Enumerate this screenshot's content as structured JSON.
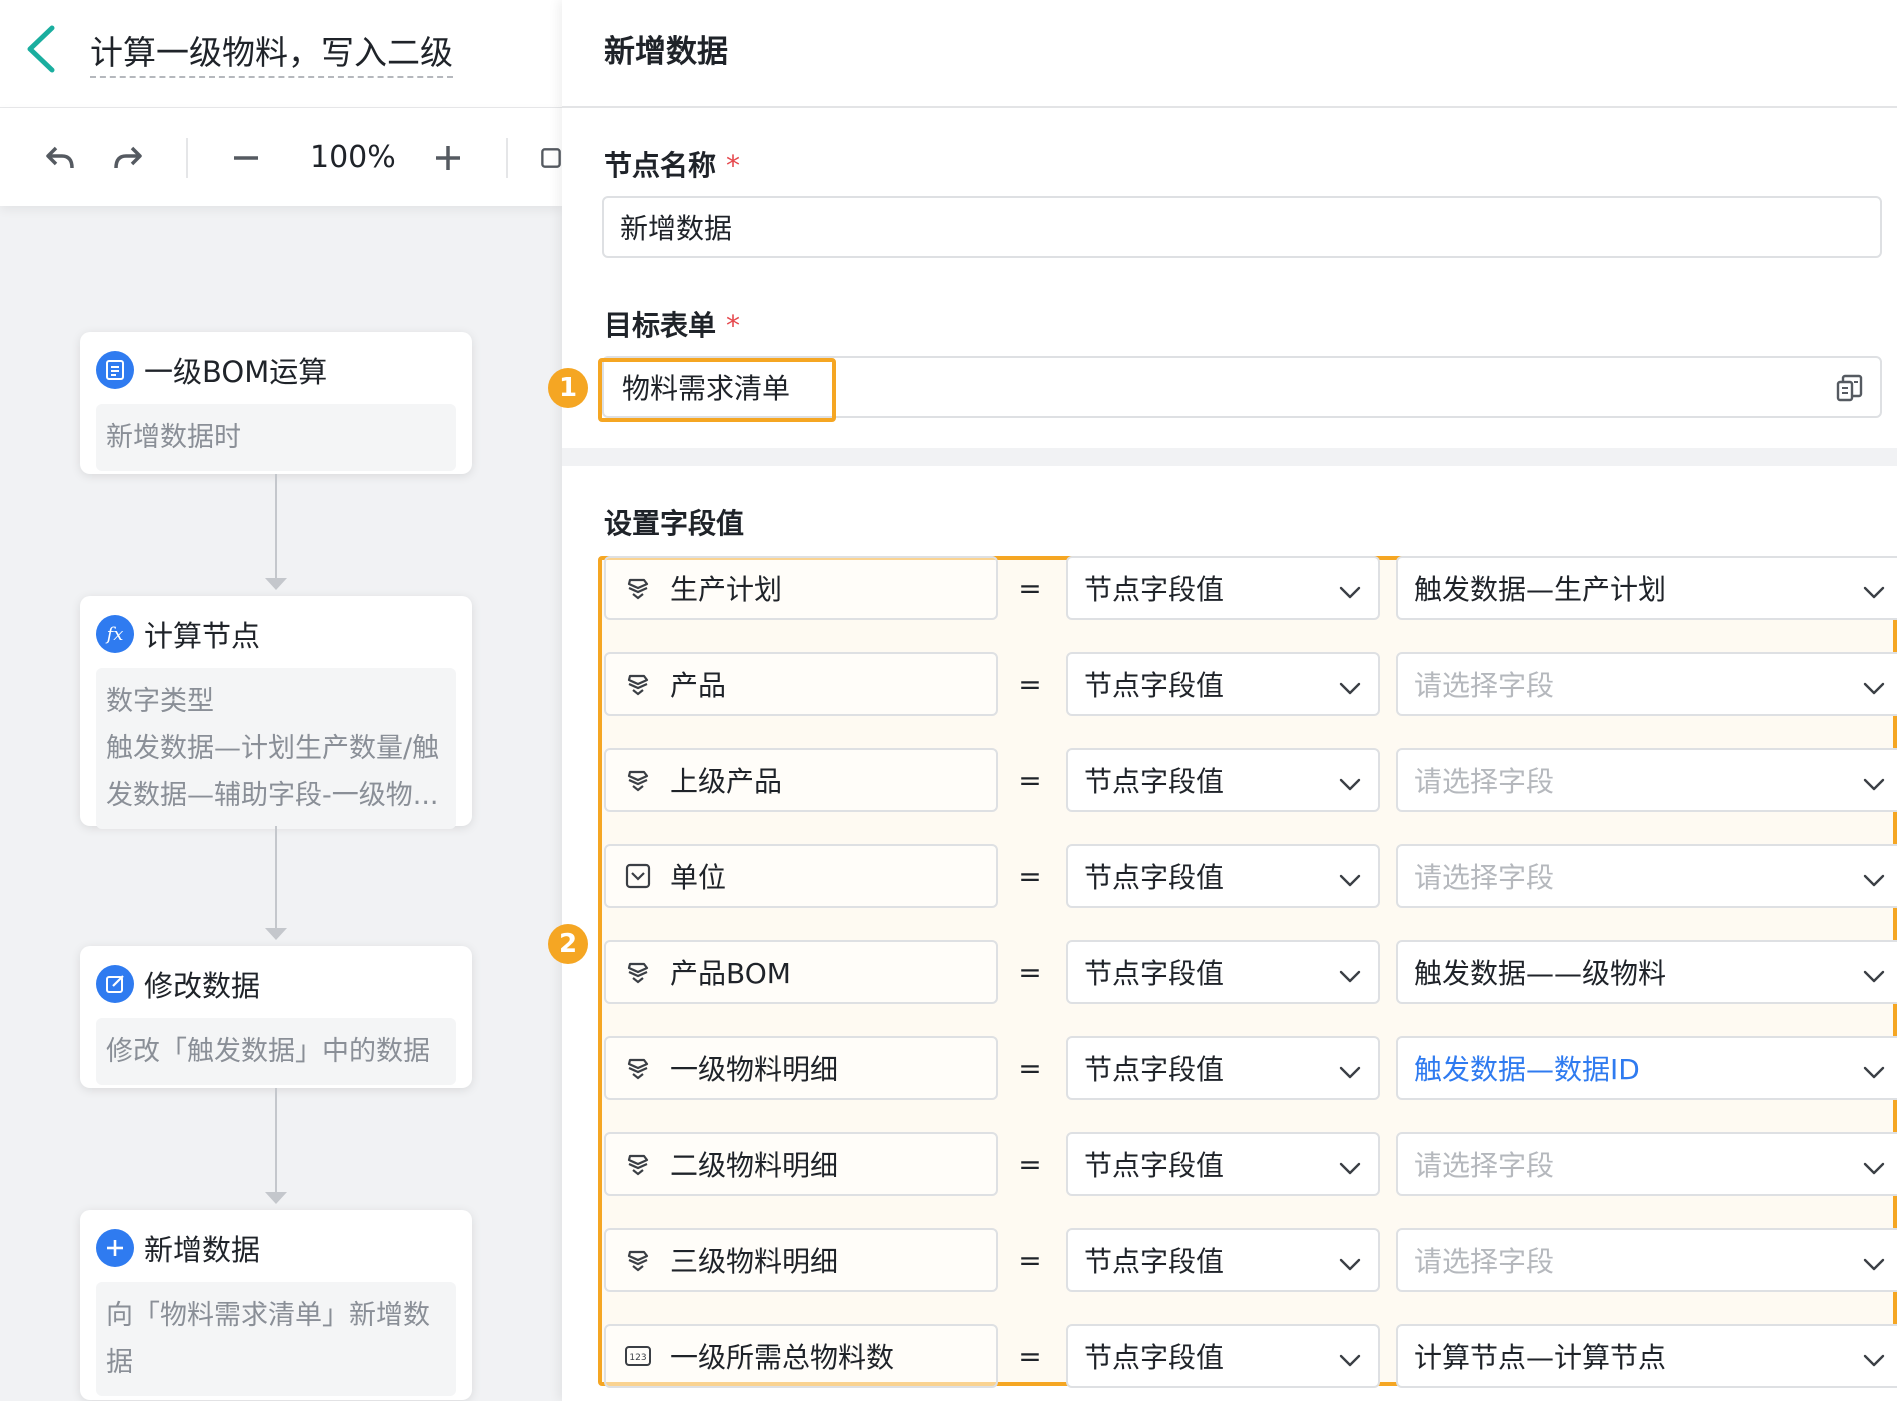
{
  "flow": {
    "title": "计算一级物料，写入二级",
    "zoom": "100%"
  },
  "nodes": [
    {
      "title": "一级BOM运算",
      "icon": "form-icon",
      "lines": [
        "新增数据时"
      ]
    },
    {
      "title": "计算节点",
      "icon": "formula-icon",
      "lines": [
        "数字类型",
        "触发数据—计划生产数量/触",
        "发数据—辅助字段-一级物..."
      ]
    },
    {
      "title": "修改数据",
      "icon": "edit-icon",
      "lines": [
        "修改「触发数据」中的数据"
      ]
    },
    {
      "title": "新增数据",
      "icon": "plus-icon",
      "lines": [
        "向「物料需求清单」新增数",
        "据"
      ]
    }
  ],
  "panel": {
    "title": "新增数据",
    "node_name_label": "节点名称",
    "node_name_value": "新增数据",
    "target_form_label": "目标表单",
    "target_form_value": "物料需求清单",
    "required_mark": "*",
    "set_fields_label": "设置字段值",
    "badge1": "1",
    "badge2": "2"
  },
  "field_rows": [
    {
      "field": "生产计划",
      "icon": "link-field-icon",
      "eq": "=",
      "type": "节点字段值",
      "value": "触发数据—生产计划",
      "state": "filled"
    },
    {
      "field": "产品",
      "icon": "link-field-icon",
      "eq": "=",
      "type": "节点字段值",
      "value": "请选择字段",
      "state": "placeholder"
    },
    {
      "field": "上级产品",
      "icon": "link-field-icon",
      "eq": "=",
      "type": "节点字段值",
      "value": "请选择字段",
      "state": "placeholder"
    },
    {
      "field": "单位",
      "icon": "dropdown-field-icon",
      "eq": "=",
      "type": "节点字段值",
      "value": "请选择字段",
      "state": "placeholder"
    },
    {
      "field": "产品BOM",
      "icon": "link-field-icon",
      "eq": "=",
      "type": "节点字段值",
      "value": "触发数据——级物料",
      "state": "filled"
    },
    {
      "field": "一级物料明细",
      "icon": "link-field-icon",
      "eq": "=",
      "type": "节点字段值",
      "value": "触发数据—数据ID",
      "state": "link"
    },
    {
      "field": "二级物料明细",
      "icon": "link-field-icon",
      "eq": "=",
      "type": "节点字段值",
      "value": "请选择字段",
      "state": "placeholder"
    },
    {
      "field": "三级物料明细",
      "icon": "link-field-icon",
      "eq": "=",
      "type": "节点字段值",
      "value": "请选择字段",
      "state": "placeholder"
    },
    {
      "field": "一级所需总物料数",
      "icon": "number-field-icon",
      "eq": "=",
      "type": "节点字段值",
      "value": "计算节点—计算节点",
      "state": "filled"
    }
  ],
  "colors": {
    "accent": "#2f7bf0",
    "highlight": "#f5a623",
    "back_arrow": "#1aae9f",
    "required": "#e5484d"
  }
}
